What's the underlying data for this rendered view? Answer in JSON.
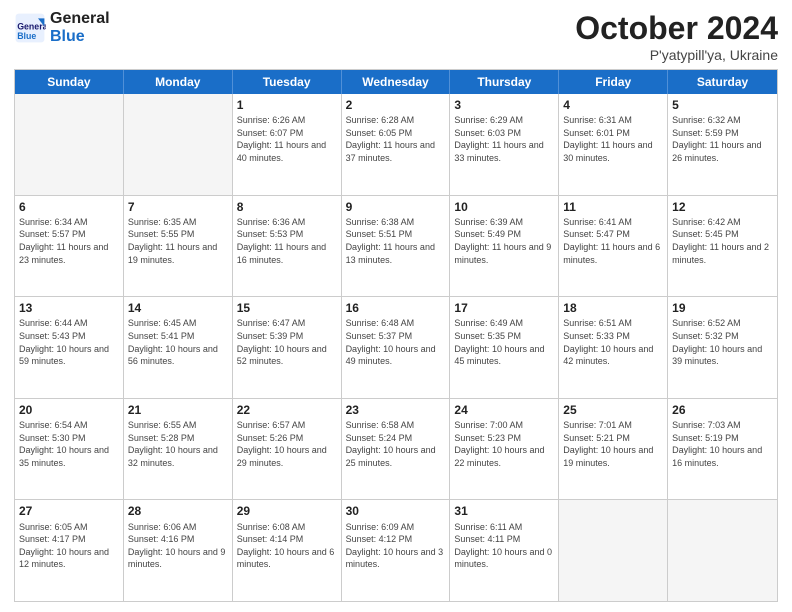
{
  "header": {
    "logo_general": "General",
    "logo_blue": "Blue",
    "title": "October 2024",
    "subtitle": "P'yatypill'ya, Ukraine"
  },
  "days_of_week": [
    "Sunday",
    "Monday",
    "Tuesday",
    "Wednesday",
    "Thursday",
    "Friday",
    "Saturday"
  ],
  "weeks": [
    [
      {
        "day": "",
        "sunrise": "",
        "sunset": "",
        "daylight": "",
        "empty": true
      },
      {
        "day": "",
        "sunrise": "",
        "sunset": "",
        "daylight": "",
        "empty": true
      },
      {
        "day": "1",
        "sunrise": "Sunrise: 6:26 AM",
        "sunset": "Sunset: 6:07 PM",
        "daylight": "Daylight: 11 hours and 40 minutes.",
        "empty": false
      },
      {
        "day": "2",
        "sunrise": "Sunrise: 6:28 AM",
        "sunset": "Sunset: 6:05 PM",
        "daylight": "Daylight: 11 hours and 37 minutes.",
        "empty": false
      },
      {
        "day": "3",
        "sunrise": "Sunrise: 6:29 AM",
        "sunset": "Sunset: 6:03 PM",
        "daylight": "Daylight: 11 hours and 33 minutes.",
        "empty": false
      },
      {
        "day": "4",
        "sunrise": "Sunrise: 6:31 AM",
        "sunset": "Sunset: 6:01 PM",
        "daylight": "Daylight: 11 hours and 30 minutes.",
        "empty": false
      },
      {
        "day": "5",
        "sunrise": "Sunrise: 6:32 AM",
        "sunset": "Sunset: 5:59 PM",
        "daylight": "Daylight: 11 hours and 26 minutes.",
        "empty": false
      }
    ],
    [
      {
        "day": "6",
        "sunrise": "Sunrise: 6:34 AM",
        "sunset": "Sunset: 5:57 PM",
        "daylight": "Daylight: 11 hours and 23 minutes.",
        "empty": false
      },
      {
        "day": "7",
        "sunrise": "Sunrise: 6:35 AM",
        "sunset": "Sunset: 5:55 PM",
        "daylight": "Daylight: 11 hours and 19 minutes.",
        "empty": false
      },
      {
        "day": "8",
        "sunrise": "Sunrise: 6:36 AM",
        "sunset": "Sunset: 5:53 PM",
        "daylight": "Daylight: 11 hours and 16 minutes.",
        "empty": false
      },
      {
        "day": "9",
        "sunrise": "Sunrise: 6:38 AM",
        "sunset": "Sunset: 5:51 PM",
        "daylight": "Daylight: 11 hours and 13 minutes.",
        "empty": false
      },
      {
        "day": "10",
        "sunrise": "Sunrise: 6:39 AM",
        "sunset": "Sunset: 5:49 PM",
        "daylight": "Daylight: 11 hours and 9 minutes.",
        "empty": false
      },
      {
        "day": "11",
        "sunrise": "Sunrise: 6:41 AM",
        "sunset": "Sunset: 5:47 PM",
        "daylight": "Daylight: 11 hours and 6 minutes.",
        "empty": false
      },
      {
        "day": "12",
        "sunrise": "Sunrise: 6:42 AM",
        "sunset": "Sunset: 5:45 PM",
        "daylight": "Daylight: 11 hours and 2 minutes.",
        "empty": false
      }
    ],
    [
      {
        "day": "13",
        "sunrise": "Sunrise: 6:44 AM",
        "sunset": "Sunset: 5:43 PM",
        "daylight": "Daylight: 10 hours and 59 minutes.",
        "empty": false
      },
      {
        "day": "14",
        "sunrise": "Sunrise: 6:45 AM",
        "sunset": "Sunset: 5:41 PM",
        "daylight": "Daylight: 10 hours and 56 minutes.",
        "empty": false
      },
      {
        "day": "15",
        "sunrise": "Sunrise: 6:47 AM",
        "sunset": "Sunset: 5:39 PM",
        "daylight": "Daylight: 10 hours and 52 minutes.",
        "empty": false
      },
      {
        "day": "16",
        "sunrise": "Sunrise: 6:48 AM",
        "sunset": "Sunset: 5:37 PM",
        "daylight": "Daylight: 10 hours and 49 minutes.",
        "empty": false
      },
      {
        "day": "17",
        "sunrise": "Sunrise: 6:49 AM",
        "sunset": "Sunset: 5:35 PM",
        "daylight": "Daylight: 10 hours and 45 minutes.",
        "empty": false
      },
      {
        "day": "18",
        "sunrise": "Sunrise: 6:51 AM",
        "sunset": "Sunset: 5:33 PM",
        "daylight": "Daylight: 10 hours and 42 minutes.",
        "empty": false
      },
      {
        "day": "19",
        "sunrise": "Sunrise: 6:52 AM",
        "sunset": "Sunset: 5:32 PM",
        "daylight": "Daylight: 10 hours and 39 minutes.",
        "empty": false
      }
    ],
    [
      {
        "day": "20",
        "sunrise": "Sunrise: 6:54 AM",
        "sunset": "Sunset: 5:30 PM",
        "daylight": "Daylight: 10 hours and 35 minutes.",
        "empty": false
      },
      {
        "day": "21",
        "sunrise": "Sunrise: 6:55 AM",
        "sunset": "Sunset: 5:28 PM",
        "daylight": "Daylight: 10 hours and 32 minutes.",
        "empty": false
      },
      {
        "day": "22",
        "sunrise": "Sunrise: 6:57 AM",
        "sunset": "Sunset: 5:26 PM",
        "daylight": "Daylight: 10 hours and 29 minutes.",
        "empty": false
      },
      {
        "day": "23",
        "sunrise": "Sunrise: 6:58 AM",
        "sunset": "Sunset: 5:24 PM",
        "daylight": "Daylight: 10 hours and 25 minutes.",
        "empty": false
      },
      {
        "day": "24",
        "sunrise": "Sunrise: 7:00 AM",
        "sunset": "Sunset: 5:23 PM",
        "daylight": "Daylight: 10 hours and 22 minutes.",
        "empty": false
      },
      {
        "day": "25",
        "sunrise": "Sunrise: 7:01 AM",
        "sunset": "Sunset: 5:21 PM",
        "daylight": "Daylight: 10 hours and 19 minutes.",
        "empty": false
      },
      {
        "day": "26",
        "sunrise": "Sunrise: 7:03 AM",
        "sunset": "Sunset: 5:19 PM",
        "daylight": "Daylight: 10 hours and 16 minutes.",
        "empty": false
      }
    ],
    [
      {
        "day": "27",
        "sunrise": "Sunrise: 6:05 AM",
        "sunset": "Sunset: 4:17 PM",
        "daylight": "Daylight: 10 hours and 12 minutes.",
        "empty": false
      },
      {
        "day": "28",
        "sunrise": "Sunrise: 6:06 AM",
        "sunset": "Sunset: 4:16 PM",
        "daylight": "Daylight: 10 hours and 9 minutes.",
        "empty": false
      },
      {
        "day": "29",
        "sunrise": "Sunrise: 6:08 AM",
        "sunset": "Sunset: 4:14 PM",
        "daylight": "Daylight: 10 hours and 6 minutes.",
        "empty": false
      },
      {
        "day": "30",
        "sunrise": "Sunrise: 6:09 AM",
        "sunset": "Sunset: 4:12 PM",
        "daylight": "Daylight: 10 hours and 3 minutes.",
        "empty": false
      },
      {
        "day": "31",
        "sunrise": "Sunrise: 6:11 AM",
        "sunset": "Sunset: 4:11 PM",
        "daylight": "Daylight: 10 hours and 0 minutes.",
        "empty": false
      },
      {
        "day": "",
        "sunrise": "",
        "sunset": "",
        "daylight": "",
        "empty": true
      },
      {
        "day": "",
        "sunrise": "",
        "sunset": "",
        "daylight": "",
        "empty": true
      }
    ]
  ]
}
